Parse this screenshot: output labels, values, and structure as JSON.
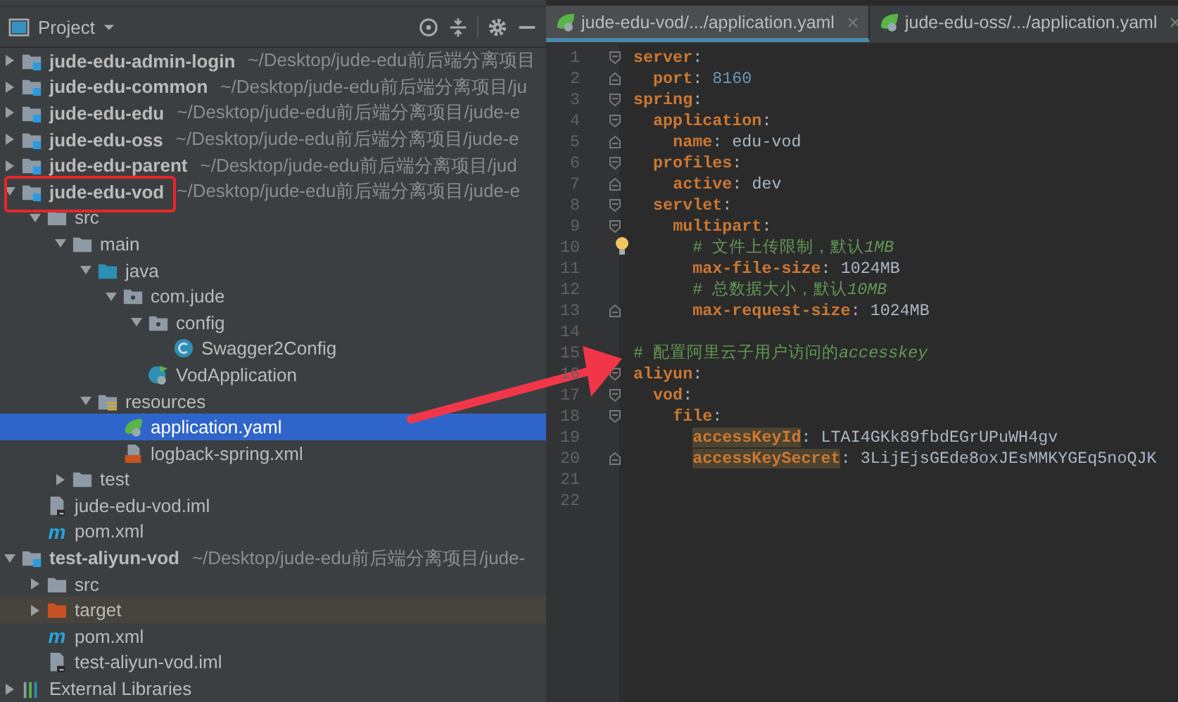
{
  "project_panel": {
    "title": "Project",
    "tree": [
      {
        "name": "jude-edu-admin-login",
        "path": "~/Desktop/jude-edu前后端分离项目",
        "kind": "module",
        "expanded": false,
        "selected": false
      },
      {
        "name": "jude-edu-common",
        "path": "~/Desktop/jude-edu前后端分离项目/ju",
        "kind": "module",
        "expanded": false,
        "selected": false
      },
      {
        "name": "jude-edu-edu",
        "path": "~/Desktop/jude-edu前后端分离项目/jude-e",
        "kind": "module",
        "expanded": false,
        "selected": false
      },
      {
        "name": "jude-edu-oss",
        "path": "~/Desktop/jude-edu前后端分离项目/jude-e",
        "kind": "module",
        "expanded": false,
        "selected": false
      },
      {
        "name": "jude-edu-parent",
        "path": "~/Desktop/jude-edu前后端分离项目/jud",
        "kind": "module",
        "expanded": false,
        "selected": false
      },
      {
        "name": "jude-edu-vod",
        "path": "~/Desktop/jude-edu前后端分离项目/jude-e",
        "kind": "module",
        "expanded": true,
        "selected": false,
        "children": [
          {
            "name": "src",
            "kind": "folder",
            "expanded": true,
            "selected": false,
            "children": [
              {
                "name": "main",
                "kind": "folder",
                "expanded": true,
                "selected": false,
                "children": [
                  {
                    "name": "java",
                    "kind": "source-folder",
                    "expanded": true,
                    "selected": false,
                    "children": [
                      {
                        "name": "com.jude",
                        "kind": "package",
                        "expanded": true,
                        "selected": false,
                        "children": [
                          {
                            "name": "config",
                            "kind": "package",
                            "expanded": true,
                            "selected": false,
                            "children": [
                              {
                                "name": "Swagger2Config",
                                "kind": "class",
                                "selected": false
                              }
                            ]
                          },
                          {
                            "name": "VodApplication",
                            "kind": "spring-class",
                            "selected": false
                          }
                        ]
                      }
                    ]
                  },
                  {
                    "name": "resources",
                    "kind": "resource-folder",
                    "expanded": true,
                    "selected": false,
                    "children": [
                      {
                        "name": "application.yaml",
                        "kind": "yaml",
                        "selected": true
                      },
                      {
                        "name": "logback-spring.xml",
                        "kind": "xml",
                        "selected": false
                      }
                    ]
                  }
                ]
              },
              {
                "name": "test",
                "kind": "folder",
                "expanded": false,
                "selected": false
              }
            ]
          },
          {
            "name": "jude-edu-vod.iml",
            "kind": "iml",
            "selected": false
          },
          {
            "name": "pom.xml",
            "kind": "maven",
            "badge": "m",
            "selected": false
          }
        ]
      },
      {
        "name": "test-aliyun-vod",
        "path": "~/Desktop/jude-edu前后端分离项目/jude-",
        "kind": "module",
        "expanded": true,
        "selected": false,
        "children": [
          {
            "name": "src",
            "kind": "folder",
            "expanded": false,
            "selected": false
          },
          {
            "name": "target",
            "kind": "excluded-folder",
            "expanded": false,
            "selected": false
          },
          {
            "name": "pom.xml",
            "kind": "maven",
            "badge": "m",
            "selected": false
          },
          {
            "name": "test-aliyun-vod.iml",
            "kind": "iml",
            "selected": false
          }
        ]
      },
      {
        "name": "External Libraries",
        "kind": "libraries",
        "expanded": false,
        "selected": false
      }
    ]
  },
  "editor": {
    "tabs": [
      {
        "label": "jude-edu-vod/.../application.yaml",
        "selected": true
      },
      {
        "label": "jude-edu-oss/.../application.yaml",
        "selected": false
      }
    ],
    "lines": [
      {
        "number": "1",
        "fold_start": true,
        "fold_end": false,
        "hint": false,
        "tokens": [
          {
            "text": "server",
            "kind": "key"
          },
          {
            "text": ":",
            "kind": "punct"
          }
        ]
      },
      {
        "number": "2",
        "fold_start": false,
        "fold_end": true,
        "hint": false,
        "tokens": [
          {
            "text": "  port",
            "kind": "key"
          },
          {
            "text": ": ",
            "kind": "punct"
          },
          {
            "text": "8160",
            "kind": "number"
          }
        ]
      },
      {
        "number": "3",
        "fold_start": true,
        "fold_end": false,
        "hint": false,
        "tokens": [
          {
            "text": "spring",
            "kind": "key"
          },
          {
            "text": ":",
            "kind": "punct"
          }
        ]
      },
      {
        "number": "4",
        "fold_start": true,
        "fold_end": false,
        "hint": false,
        "tokens": [
          {
            "text": "  application",
            "kind": "key"
          },
          {
            "text": ":",
            "kind": "punct"
          }
        ]
      },
      {
        "number": "5",
        "fold_start": false,
        "fold_end": true,
        "hint": false,
        "tokens": [
          {
            "text": "    name",
            "kind": "key"
          },
          {
            "text": ": ",
            "kind": "punct"
          },
          {
            "text": "edu-vod",
            "kind": "plain"
          }
        ]
      },
      {
        "number": "6",
        "fold_start": true,
        "fold_end": false,
        "hint": false,
        "tokens": [
          {
            "text": "  profiles",
            "kind": "key"
          },
          {
            "text": ":",
            "kind": "punct"
          }
        ]
      },
      {
        "number": "7",
        "fold_start": false,
        "fold_end": true,
        "hint": false,
        "tokens": [
          {
            "text": "    active",
            "kind": "key"
          },
          {
            "text": ": ",
            "kind": "punct"
          },
          {
            "text": "dev",
            "kind": "plain"
          }
        ]
      },
      {
        "number": "8",
        "fold_start": true,
        "fold_end": false,
        "hint": false,
        "tokens": [
          {
            "text": "  servlet",
            "kind": "key"
          },
          {
            "text": ":",
            "kind": "punct"
          }
        ]
      },
      {
        "number": "9",
        "fold_start": true,
        "fold_end": false,
        "hint": false,
        "tokens": [
          {
            "text": "    multipart",
            "kind": "key"
          },
          {
            "text": ":",
            "kind": "punct"
          }
        ]
      },
      {
        "number": "10",
        "fold_start": false,
        "fold_end": false,
        "hint": true,
        "tokens": [
          {
            "text": "      # 文件上传限制，默认",
            "kind": "comment"
          },
          {
            "text": "1MB",
            "kind": "comment-italic"
          }
        ]
      },
      {
        "number": "11",
        "fold_start": false,
        "fold_end": false,
        "hint": false,
        "tokens": [
          {
            "text": "      max-file-size",
            "kind": "key"
          },
          {
            "text": ": ",
            "kind": "punct"
          },
          {
            "text": "1024MB",
            "kind": "plain"
          }
        ]
      },
      {
        "number": "12",
        "fold_start": false,
        "fold_end": false,
        "hint": false,
        "tokens": [
          {
            "text": "      # 总数据大小，默认",
            "kind": "comment"
          },
          {
            "text": "10MB",
            "kind": "comment-italic"
          }
        ]
      },
      {
        "number": "13",
        "fold_start": false,
        "fold_end": true,
        "hint": false,
        "tokens": [
          {
            "text": "      max-request-size",
            "kind": "key"
          },
          {
            "text": ": ",
            "kind": "punct"
          },
          {
            "text": "1024MB",
            "kind": "plain"
          }
        ]
      },
      {
        "number": "14",
        "fold_start": false,
        "fold_end": false,
        "hint": false
      },
      {
        "number": "15",
        "fold_start": false,
        "fold_end": false,
        "hint": false,
        "tokens": [
          {
            "text": "# 配置阿里云子用户访问的",
            "kind": "comment"
          },
          {
            "text": "accesskey",
            "kind": "comment-italic"
          }
        ]
      },
      {
        "number": "16",
        "fold_start": true,
        "fold_end": false,
        "hint": false,
        "tokens": [
          {
            "text": "aliyun",
            "kind": "key"
          },
          {
            "text": ":",
            "kind": "punct"
          }
        ]
      },
      {
        "number": "17",
        "fold_start": true,
        "fold_end": false,
        "hint": false,
        "tokens": [
          {
            "text": "  vod",
            "kind": "key"
          },
          {
            "text": ":",
            "kind": "punct"
          }
        ]
      },
      {
        "number": "18",
        "fold_start": true,
        "fold_end": false,
        "hint": false,
        "tokens": [
          {
            "text": "    file",
            "kind": "key"
          },
          {
            "text": ":",
            "kind": "punct"
          }
        ]
      },
      {
        "number": "19",
        "fold_start": false,
        "fold_end": false,
        "hint": false,
        "tokens": [
          {
            "text": "      accessKeyId",
            "kind": "key-marked"
          },
          {
            "text": ": ",
            "kind": "punct"
          },
          {
            "text": "LTAI4GKk89fbdEGrUPuWH4gv",
            "kind": "plain"
          }
        ]
      },
      {
        "number": "20",
        "fold_start": false,
        "fold_end": true,
        "hint": false,
        "tokens": [
          {
            "text": "      accessKeySecret",
            "kind": "key-marked"
          },
          {
            "text": ": ",
            "kind": "punct"
          },
          {
            "text": "3LijEjsGEde8oxJEsMMKYGEq5noQJK",
            "kind": "plain"
          }
        ]
      },
      {
        "number": "21",
        "fold_start": false,
        "fold_end": false,
        "hint": false
      },
      {
        "number": "22",
        "fold_start": false,
        "fold_end": false,
        "hint": false
      }
    ]
  }
}
